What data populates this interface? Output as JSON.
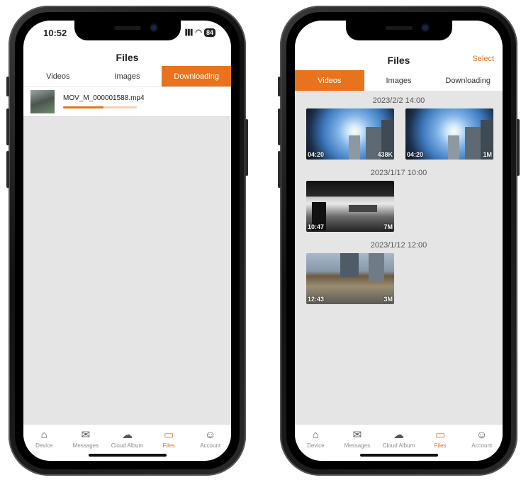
{
  "left_phone": {
    "status": {
      "time": "10:52",
      "signal": "▌▌▌",
      "wifi": "◠",
      "battery": "84"
    },
    "title": "Files",
    "tabs": [
      {
        "label": "Videos",
        "active": false
      },
      {
        "label": "Images",
        "active": false
      },
      {
        "label": "Downloading",
        "active": true
      }
    ],
    "download": {
      "file_name": "MOV_M_000001588.mp4",
      "progress": 0.55
    }
  },
  "right_phone": {
    "title": "Files",
    "select_label": "Select",
    "tabs": [
      {
        "label": "Videos",
        "active": true
      },
      {
        "label": "Images",
        "active": false
      },
      {
        "label": "Downloading",
        "active": false
      }
    ],
    "groups": [
      {
        "date": "2023/2/2 14:00",
        "items": [
          {
            "duration": "04:20",
            "size": "438K"
          },
          {
            "duration": "04:20",
            "size": "1M"
          }
        ]
      },
      {
        "date": "2023/1/17 10:00",
        "items": [
          {
            "duration": "10:47",
            "size": "7M"
          }
        ]
      },
      {
        "date": "2023/1/12 12:00",
        "items": [
          {
            "duration": "12:43",
            "size": "3M"
          }
        ]
      }
    ]
  },
  "tabbar": [
    {
      "label": "Device",
      "icon": "home-icon",
      "glyph": "⌂"
    },
    {
      "label": "Messages",
      "icon": "envelope-icon",
      "glyph": "✉"
    },
    {
      "label": "Cloud Album",
      "icon": "cloud-upload-icon",
      "glyph": "☁"
    },
    {
      "label": "Files",
      "icon": "folder-icon",
      "glyph": "▭"
    },
    {
      "label": "Account",
      "icon": "user-icon",
      "glyph": "☺"
    }
  ],
  "colors": {
    "accent": "#e8731c",
    "background": "#e5e5e5"
  }
}
